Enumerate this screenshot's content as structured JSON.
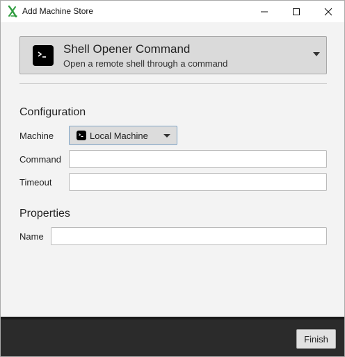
{
  "window": {
    "title": "Add Machine Store"
  },
  "provider": {
    "title": "Shell Opener Command",
    "description": "Open a remote shell through a command",
    "icon": "terminal-icon"
  },
  "configuration": {
    "heading": "Configuration",
    "machine_label": "Machine",
    "machine_value": "Local Machine",
    "command_label": "Command",
    "command_value": "",
    "timeout_label": "Timeout",
    "timeout_value": ""
  },
  "properties": {
    "heading": "Properties",
    "name_label": "Name",
    "name_value": ""
  },
  "footer": {
    "finish_label": "Finish"
  },
  "colors": {
    "app_icon": "#2e9c3e",
    "content_bg": "#f3f3f3",
    "footer_bg": "#2b2b2b"
  }
}
